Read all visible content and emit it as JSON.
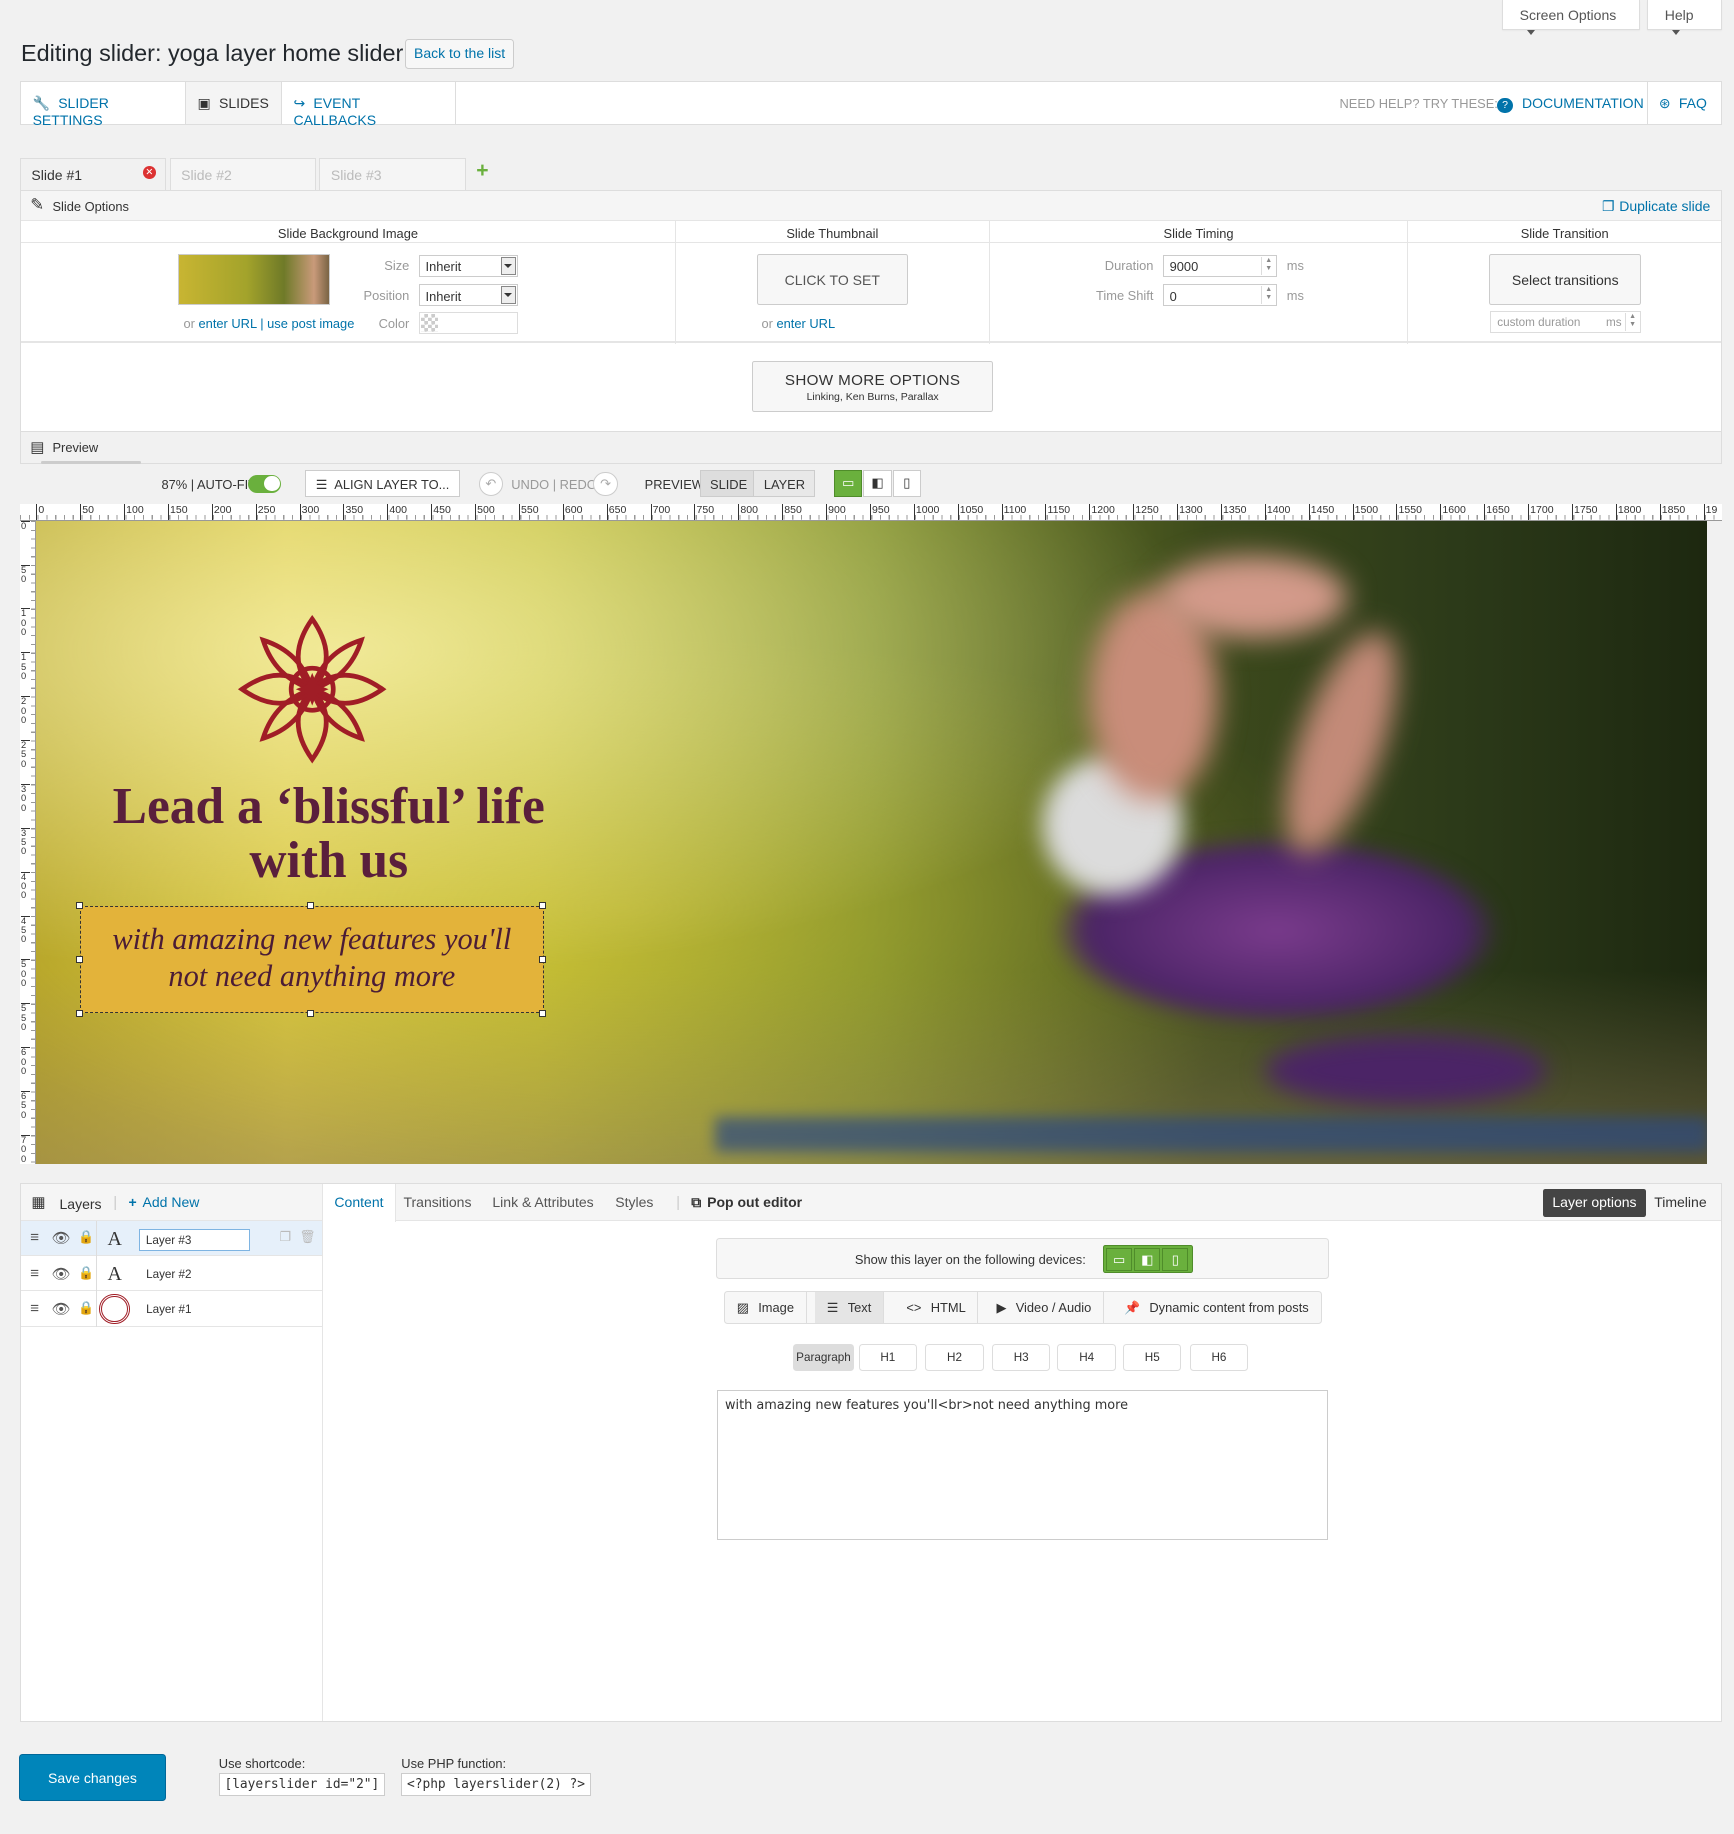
{
  "header": {
    "screen_options": "Screen Options",
    "help": "Help",
    "title": "Editing slider: yoga layer home slider",
    "back_button": "Back to the list"
  },
  "nav": {
    "slider_settings": "SLIDER SETTINGS",
    "slides": "SLIDES",
    "event_callbacks": "EVENT CALLBACKS",
    "need_help": "NEED HELP? TRY THESE:",
    "documentation": "DOCUMENTATION",
    "faq": "FAQ"
  },
  "slide_tabs": [
    "Slide #1",
    "Slide #2",
    "Slide #3"
  ],
  "add_slide": "+",
  "slide_options": {
    "title": "Slide Options",
    "duplicate": "Duplicate slide",
    "bg_image_head": "Slide Background Image",
    "size_label": "Size",
    "size_value": "Inherit",
    "position_label": "Position",
    "position_value": "Inherit",
    "color_label": "Color",
    "or": "or",
    "enter_url": "enter URL",
    "sep": "|",
    "use_post_image": "use post image",
    "thumbnail_head": "Slide Thumbnail",
    "click_to_set": "CLICK TO SET",
    "timing_head": "Slide Timing",
    "duration_label": "Duration",
    "duration_value": "9000",
    "timeshift_label": "Time Shift",
    "timeshift_value": "0",
    "ms": "ms",
    "transition_head": "Slide Transition",
    "select_transitions": "Select transitions",
    "custom_duration": "custom duration",
    "show_more": "SHOW MORE OPTIONS",
    "show_more_sub": "Linking, Ken Burns, Parallax"
  },
  "preview": {
    "title": "Preview",
    "zoom": "87% | AUTO-FIT",
    "align": "ALIGN LAYER TO...",
    "undo": "UNDO",
    "redo": "REDO",
    "preview_label": "PREVIEW",
    "slide": "SLIDE",
    "layer": "LAYER",
    "ruler_h": [
      "0",
      "50",
      "100",
      "150",
      "200",
      "250",
      "300",
      "350",
      "400",
      "450",
      "500",
      "550",
      "600",
      "650",
      "700",
      "750",
      "800",
      "850",
      "900",
      "950",
      "1000",
      "1050",
      "1100",
      "1150",
      "1200",
      "1250",
      "1300",
      "1350",
      "1400",
      "1450",
      "1500",
      "1550",
      "1600",
      "1650",
      "1700",
      "1750",
      "1800",
      "1850",
      "19"
    ],
    "ruler_v": [
      "0",
      "50",
      "100",
      "150",
      "200",
      "250",
      "300",
      "350",
      "400",
      "450",
      "500",
      "550",
      "600",
      "650",
      "700"
    ]
  },
  "stage": {
    "headline_1": "Lead a ‘blissful’ life",
    "headline_2": "with us",
    "sub_1": "with amazing new features you'll",
    "sub_2": "not need anything more",
    "accent": "#5a1f3c",
    "box_color": "#e3b33a"
  },
  "layers": {
    "title": "Layers",
    "add_new": "Add New",
    "items": [
      {
        "name": "Layer #3",
        "type": "A"
      },
      {
        "name": "Layer #2",
        "type": "A"
      },
      {
        "name": "Layer #1",
        "type": "image"
      }
    ]
  },
  "editor": {
    "tabs": [
      "Content",
      "Transitions",
      "Link & Attributes",
      "Styles"
    ],
    "pop_out": "Pop out editor",
    "layer_options": "Layer options",
    "timeline": "Timeline",
    "devices_label": "Show this layer on the following devices:",
    "types": [
      "Image",
      "Text",
      "HTML",
      "Video / Audio",
      "Dynamic content from posts"
    ],
    "tags": [
      "Paragraph",
      "H1",
      "H2",
      "H3",
      "H4",
      "H5",
      "H6"
    ],
    "content": "with amazing new features you'll<br>not need anything more"
  },
  "footer": {
    "save": "Save changes",
    "shortcode_label": "Use shortcode:",
    "shortcode": "[layerslider id=\"2\"]",
    "php_label": "Use PHP function:",
    "php": "<?php layerslider(2) ?>"
  }
}
